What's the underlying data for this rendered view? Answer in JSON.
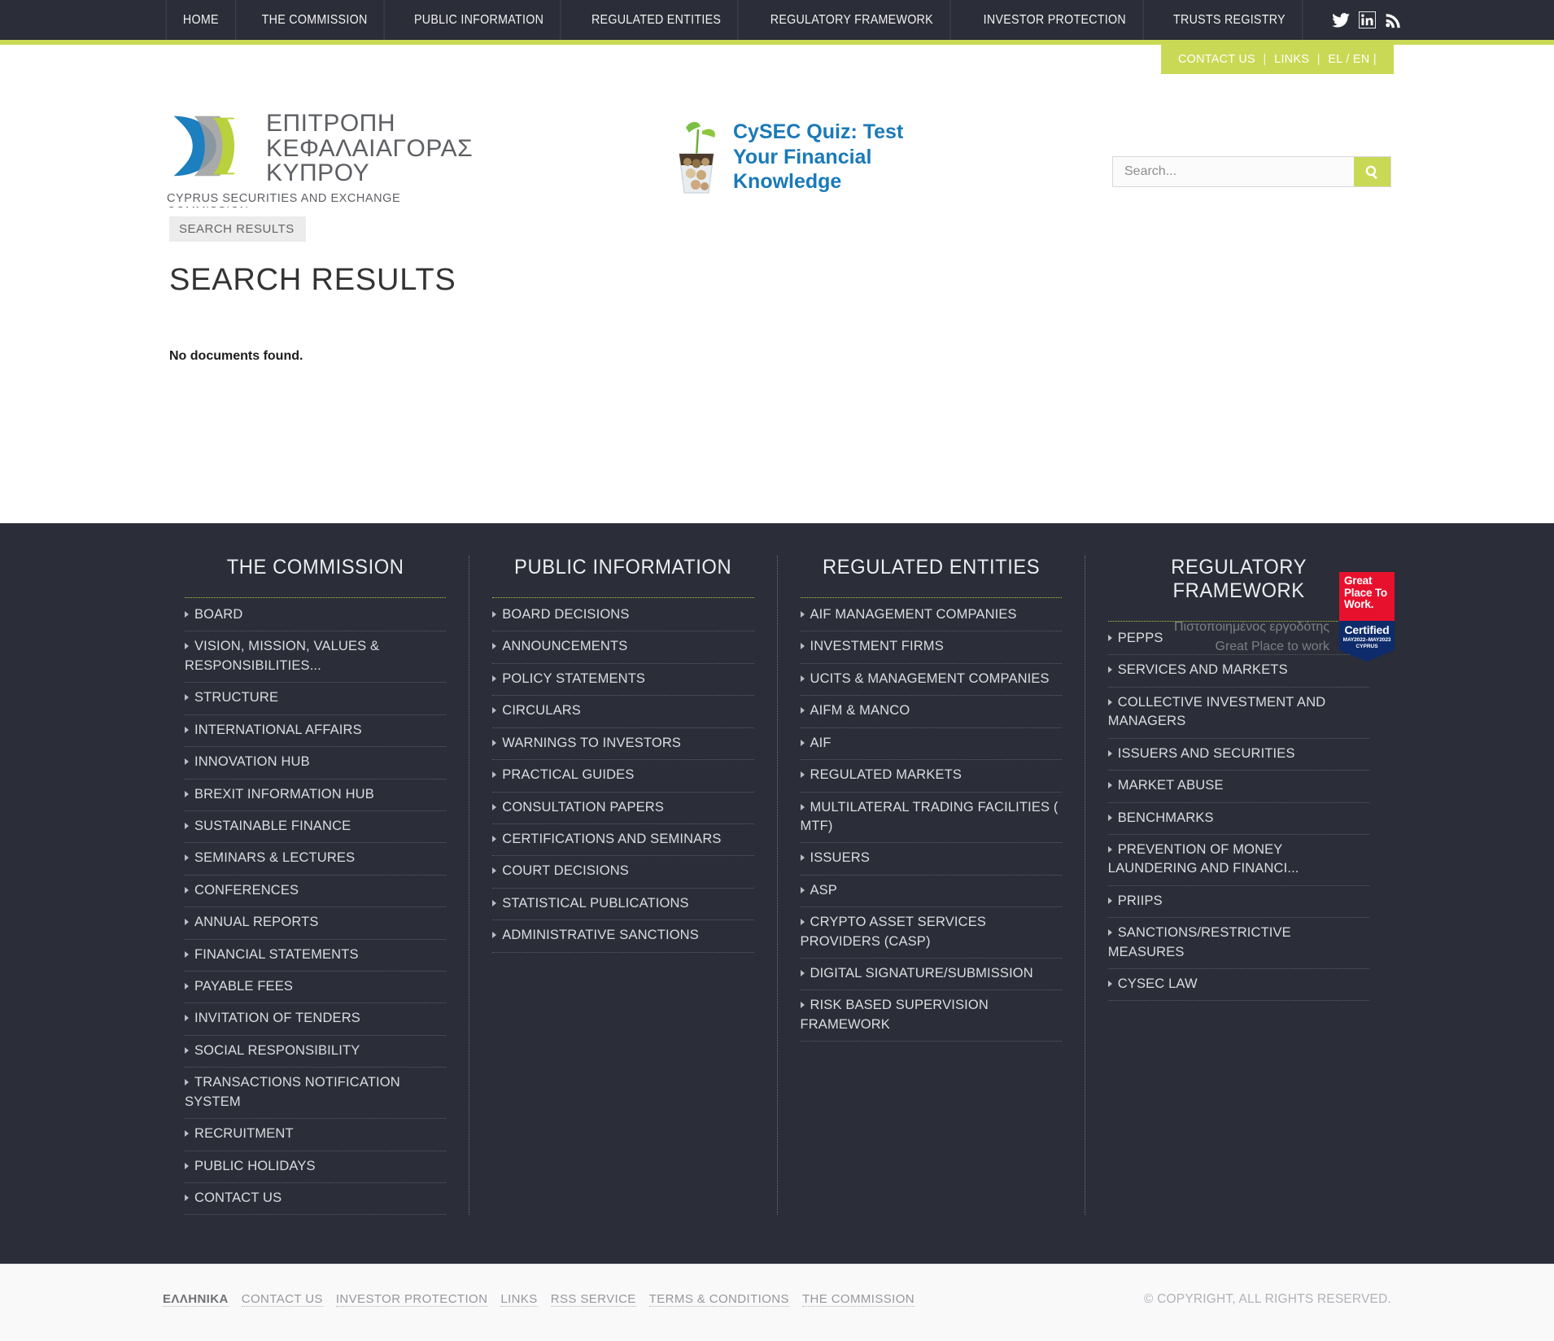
{
  "topnav": {
    "items": [
      {
        "label": "HOME",
        "name": "nav-home"
      },
      {
        "label": "THE COMMISSION",
        "name": "nav-the-commission"
      },
      {
        "label": "PUBLIC INFORMATION",
        "name": "nav-public-information"
      },
      {
        "label": "REGULATED ENTITIES",
        "name": "nav-regulated-entities"
      },
      {
        "label": "REGULATORY FRAMEWORK",
        "name": "nav-regulatory-framework"
      },
      {
        "label": "INVESTOR PROTECTION",
        "name": "nav-investor-protection"
      },
      {
        "label": "TRUSTS REGISTRY",
        "name": "nav-trusts-registry"
      }
    ],
    "social": [
      "twitter-icon",
      "linkedin-icon",
      "rss-icon"
    ],
    "accent_color": "#c9d955",
    "bar_color": "#2b2d38"
  },
  "utilbar": {
    "contact": "CONTACT US",
    "sep1": "|",
    "links": "LINKS",
    "sep2": "|",
    "lang": "EL / EN |"
  },
  "logo": {
    "title": "ΕΠΙΤΡΟΠΗ\nΚΕΦΑΛΑΙΑΓΟΡΑΣ\nΚΥΠΡΟΥ",
    "subtitle": "CYPRUS SECURITIES AND EXCHANGE COMMISSION"
  },
  "quiz": {
    "title": "CySEC Quiz: Test\nYour Financial\nKnowledge",
    "icon": "money-plant-icon",
    "color": "#1a7ab8"
  },
  "search": {
    "placeholder": "Search...",
    "value": "",
    "button_icon": "search-icon"
  },
  "main": {
    "breadcrumb": "SEARCH RESULTS",
    "page_title": "SEARCH RESULTS",
    "message": "No documents found."
  },
  "gptw": {
    "caption": "Πιστοποιημένος εργοδότης\nGreat Place to work",
    "badge_top": "Great\nPlace\nTo\nWork.",
    "badge_certified": "Certified",
    "badge_dates": "MAY2022–MAY2023",
    "badge_country": "CYPRUS"
  },
  "footer": {
    "columns": [
      {
        "title": "THE COMMISSION",
        "items": [
          "BOARD",
          "VISION, MISSION, VALUES & RESPONSIBILITIES...",
          "STRUCTURE",
          "INTERNATIONAL AFFAIRS",
          "INNOVATION HUB",
          "BREXIT INFORMATION HUB",
          "SUSTAINABLE FINANCE",
          "SEMINARS & LECTURES",
          "CONFERENCES",
          "ANNUAL REPORTS",
          "FINANCIAL STATEMENTS",
          "PAYABLE FEES",
          "INVITATION OF TENDERS",
          "SOCIAL RESPONSIBILITY",
          "TRANSACTIONS NOTIFICATION SYSTEM",
          "RECRUITMENT",
          "PUBLIC HOLIDAYS",
          "CONTACT US"
        ]
      },
      {
        "title": "PUBLIC INFORMATION",
        "items": [
          "BOARD DECISIONS",
          "ANNOUNCEMENTS",
          "POLICY STATEMENTS",
          "CIRCULARS",
          "WARNINGS TO INVESTORS",
          "PRACTICAL GUIDES",
          "CONSULTATION PAPERS",
          "CERTIFICATIONS AND SEMINARS",
          "COURT DECISIONS",
          "STATISTICAL PUBLICATIONS",
          "ADMINISTRATIVE SANCTIONS"
        ]
      },
      {
        "title": "REGULATED ENTITIES",
        "items": [
          "AIF MANAGEMENT COMPANIES",
          "INVESTMENT FIRMS",
          "UCITS & MANAGEMENT COMPANIES",
          "AIFM & MANCO",
          "AIF",
          "REGULATED MARKETS",
          "MULTILATERAL TRADING FACILITIES ( MTF)",
          "ISSUERS",
          "ASP",
          "CRYPTO ASSET SERVICES PROVIDERS (CASP)",
          "DIGITAL SIGNATURE/SUBMISSION",
          "RISK BASED SUPERVISION FRAMEWORK"
        ]
      },
      {
        "title": "REGULATORY FRAMEWORK",
        "items": [
          "PEPPS",
          "SERVICES AND MARKETS",
          "COLLECTIVE INVESTMENT AND MANAGERS",
          "ISSUERS AND SECURITIES",
          "MARKET ABUSE",
          "BENCHMARKS",
          "PREVENTION OF MONEY LAUNDERING AND FINANCI...",
          "PRIIPS",
          "SANCTIONS/RESTRICTIVE MEASURES",
          "CYSEC LAW"
        ]
      }
    ]
  },
  "bottombar": {
    "links": [
      "ΕΛΛΗΝΙΚΑ",
      "CONTACT US",
      "INVESTOR PROTECTION",
      "LINKS",
      "RSS SERVICE",
      "TERMS & CONDITIONS",
      "THE COMMISSION"
    ],
    "copyright": "© COPYRIGHT, ALL RIGHTS RESERVED."
  }
}
